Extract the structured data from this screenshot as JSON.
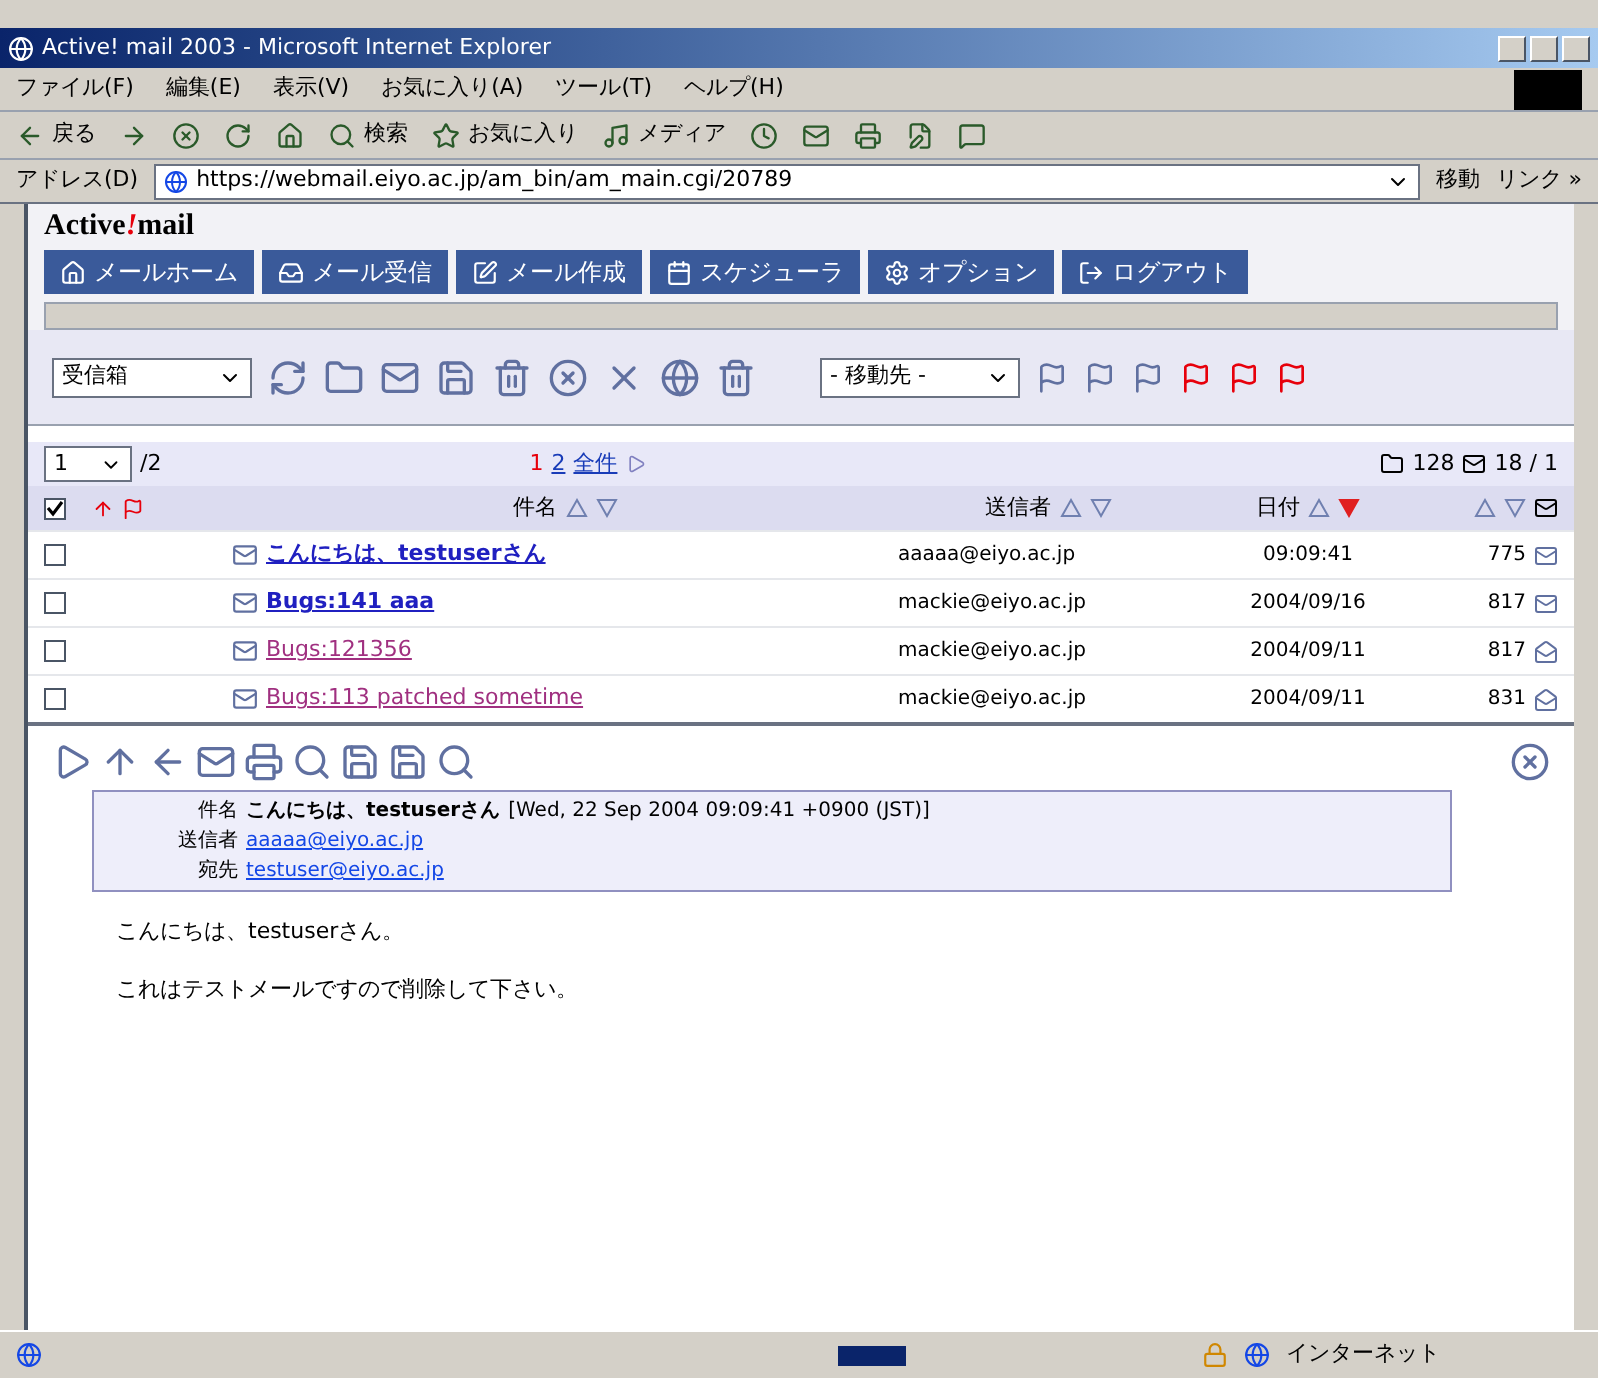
{
  "window": {
    "title": "Active! mail 2003 - Microsoft Internet Explorer"
  },
  "menu": [
    "ファイル(F)",
    "編集(E)",
    "表示(V)",
    "お気に入り(A)",
    "ツール(T)",
    "ヘルプ(H)"
  ],
  "toolbar": [
    {
      "kind": "back",
      "label": "戻る"
    },
    {
      "kind": "forward"
    },
    {
      "kind": "stop"
    },
    {
      "kind": "refresh"
    },
    {
      "kind": "home"
    },
    {
      "kind": "search",
      "label": "検索"
    },
    {
      "kind": "favorites",
      "label": "お気に入り"
    },
    {
      "kind": "media",
      "label": "メディア"
    },
    {
      "kind": "history"
    },
    {
      "kind": "mail"
    },
    {
      "kind": "print"
    },
    {
      "kind": "edit"
    },
    {
      "kind": "discuss"
    }
  ],
  "address": {
    "label": "アドレス(D)",
    "value": "https://webmail.eiyo.ac.jp/am_bin/am_main.cgi/20789",
    "go": "移動",
    "links": "リンク »"
  },
  "app": {
    "logo_left": "Active",
    "logo_mark": "!",
    "logo_right": "mail",
    "tabs": [
      {
        "label": "メールホーム",
        "kind": "home"
      },
      {
        "label": "メール受信",
        "kind": "inbox"
      },
      {
        "label": "メール作成",
        "kind": "compose"
      },
      {
        "label": "スケジューラ",
        "kind": "schedule"
      },
      {
        "label": "オプション",
        "kind": "options"
      },
      {
        "label": "ログアウト",
        "kind": "logout"
      }
    ],
    "folder": "受信箱",
    "move_to": "- 移動先 -",
    "list": {
      "page": "1",
      "pages": "/2",
      "page_links": [
        "1",
        "2",
        "全件"
      ],
      "total": "128",
      "unread": "18 / 1",
      "all_checked": true,
      "columns": [
        "件名",
        "送信者",
        "日付"
      ],
      "rows": [
        {
          "subject": "こんにちは、testuserさん",
          "sender": "aaaaa@eiyo.ac.jp",
          "date": "09:09:41",
          "size": "775",
          "unread": true,
          "checked": false
        },
        {
          "subject": "Bugs:141 aaa",
          "sender": "mackie@eiyo.ac.jp",
          "date": "2004/09/16",
          "size": "817",
          "unread": true,
          "checked": false
        },
        {
          "subject": "Bugs:121356",
          "sender": "mackie@eiyo.ac.jp",
          "date": "2004/09/11",
          "size": "817",
          "unread": false,
          "checked": false
        },
        {
          "subject": "Bugs:113 patched sometime",
          "sender": "mackie@eiyo.ac.jp",
          "date": "2004/09/11",
          "size": "831",
          "unread": false,
          "checked": false
        }
      ]
    },
    "preview": {
      "subject_label": "件名",
      "subject": "こんにちは、testuserさん",
      "date": "[Wed, 22 Sep 2004 09:09:41 +0900 (JST)]",
      "from_label": "送信者",
      "from": "aaaaa@eiyo.ac.jp",
      "to_label": "宛先",
      "to": "testuser@eiyo.ac.jp",
      "body": [
        "こんにちは、testuserさん。",
        "これはテストメールですので削除して下さい。"
      ]
    }
  },
  "status_bar": {
    "zone": "インターネット"
  }
}
